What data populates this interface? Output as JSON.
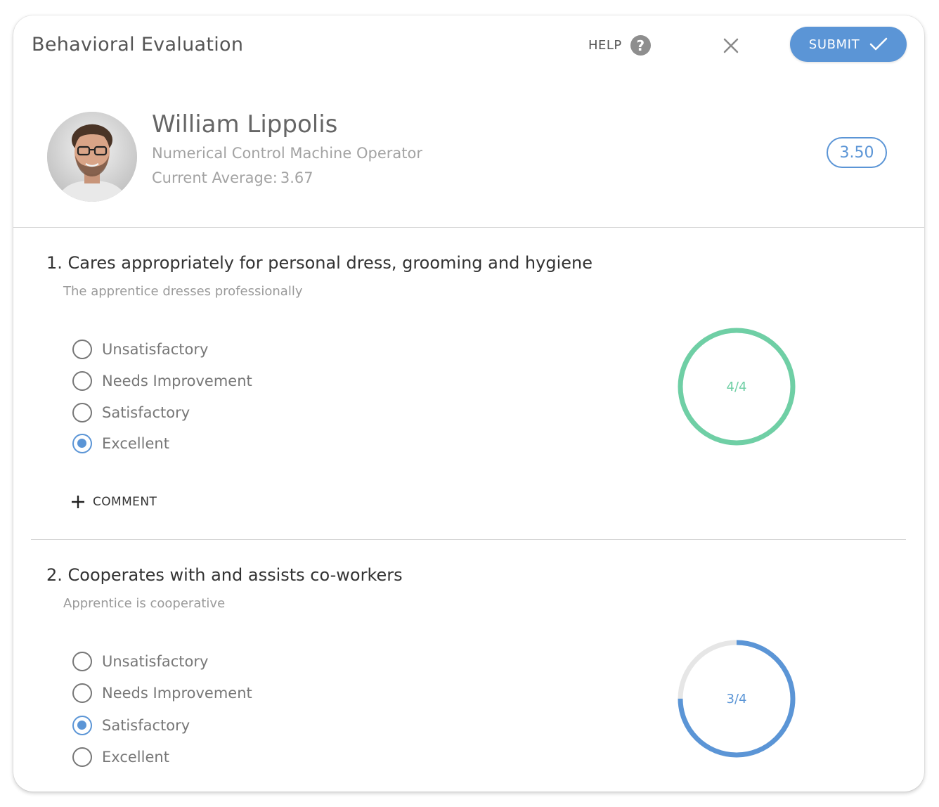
{
  "header": {
    "title": "Behavioral Evaluation",
    "help_label": "HELP",
    "help_glyph": "?",
    "submit_label": "SUBMIT"
  },
  "profile": {
    "name": "William Lippolis",
    "job_title": "Numerical Control Machine Operator",
    "average_label": "Current Average:",
    "average_value": "3.67",
    "score": "3.50"
  },
  "colors": {
    "accent": "#5b95d6",
    "complete": "#6fcfa5",
    "track": "#e6e6e6"
  },
  "questions": [
    {
      "title": "1. Cares appropriately for personal dress, grooming and hygiene",
      "subtitle": "The apprentice dresses professionally",
      "options": [
        {
          "label": "Unsatisfactory",
          "selected": false
        },
        {
          "label": "Needs Improvement",
          "selected": false
        },
        {
          "label": "Satisfactory",
          "selected": false
        },
        {
          "label": "Excellent",
          "selected": true
        }
      ],
      "comment_label": "COMMENT",
      "score_text": "4/4",
      "score_fraction": 1.0
    },
    {
      "title": "2. Cooperates with and assists co-workers",
      "subtitle": "Apprentice is cooperative",
      "options": [
        {
          "label": "Unsatisfactory",
          "selected": false
        },
        {
          "label": "Needs Improvement",
          "selected": false
        },
        {
          "label": "Satisfactory",
          "selected": true
        },
        {
          "label": "Excellent",
          "selected": false
        }
      ],
      "score_text": "3/4",
      "score_fraction": 0.75
    }
  ]
}
